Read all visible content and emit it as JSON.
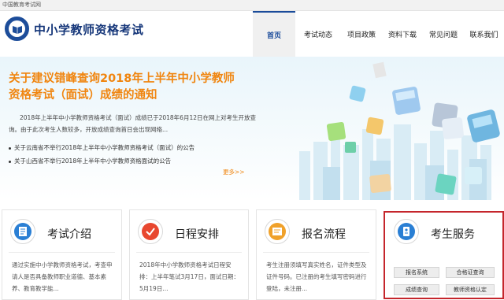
{
  "topbar": {
    "text": "中国教育考试网"
  },
  "header": {
    "site_title": "中小学教师资格考试",
    "nav": [
      "首页",
      "考试动态",
      "项目政策",
      "资料下载",
      "常见问题",
      "联系我们"
    ],
    "active_index": 0
  },
  "banner": {
    "title": "关于建议错峰查询2018年上半年中小学教师资格考试（面试）成绩的通知",
    "text": "2018年上半年中小学教师资格考试（面试）成绩已于2018年6月12日在网上对考生开放查询。由于此次考生人数较多，开放成绩查询首日会出现网络...",
    "news": [
      "关于云南省不举行2018年上半年中小学教师资格考试（面试）的公告",
      "关于山西省不举行2018年上半年中小学教师资格面试的公告"
    ],
    "more": "更多>>"
  },
  "cards": [
    {
      "title": "考试介绍",
      "text": "通过实施中小学教师资格考试，考查申请人是否具备教师职业道德、基本素养、教育教学能..."
    },
    {
      "title": "日程安排",
      "text": "2018年中小学教师资格考试日程安排：上半年笔试3月17日，面试日期：5月19日..."
    },
    {
      "title": "报名流程",
      "text": "考生注册须填写真实姓名，证件类型及证件号码。已注册的考生填写密码进行登陆，未注册..."
    },
    {
      "title": "考生服务",
      "buttons": [
        "报名系统",
        "合格证查询",
        "成绩查询",
        "教师资格认定"
      ]
    }
  ],
  "colors": {
    "brand": "#16377a",
    "accent": "#f0850f",
    "highlight": "#c5262c"
  }
}
